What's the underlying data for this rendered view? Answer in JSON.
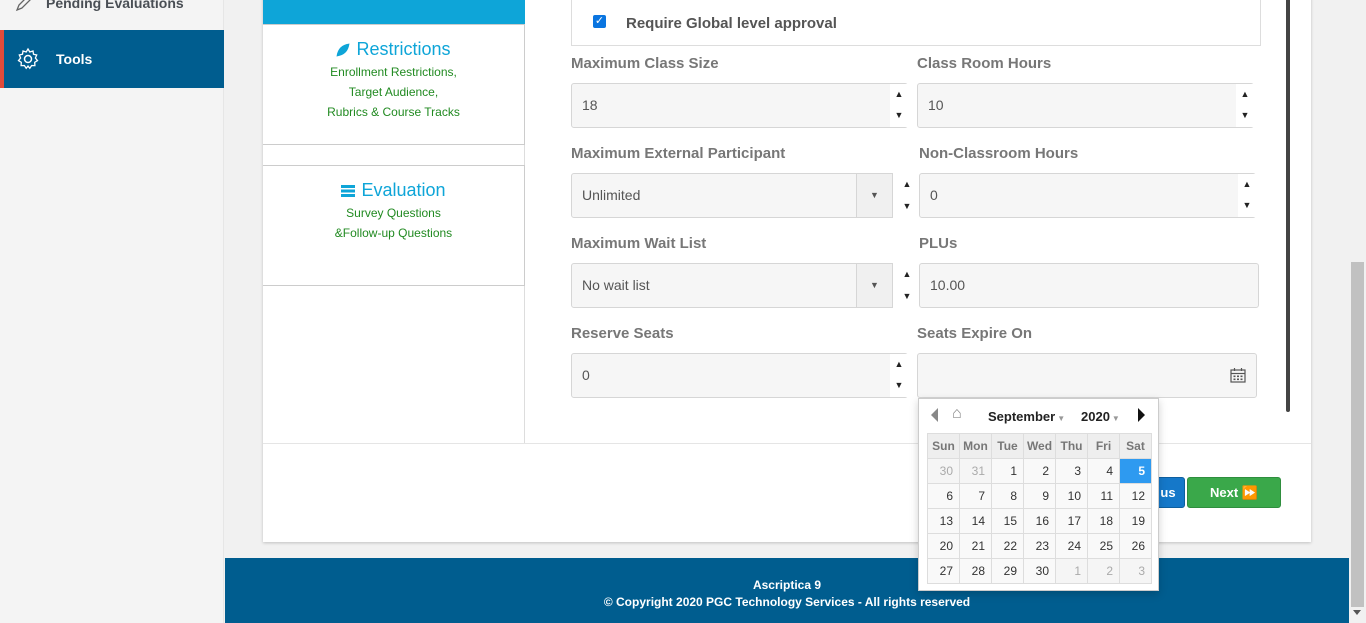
{
  "sidebar": {
    "items": [
      {
        "label": "Pending Evaluations",
        "icon": "pencil-icon"
      },
      {
        "label": "Tools",
        "icon": "gear-icon",
        "active": true
      }
    ]
  },
  "leftnav": {
    "restrictions": {
      "title": "Restrictions",
      "lines": [
        "Enrollment Restrictions,",
        "Target Audience,",
        "Rubrics & Course Tracks"
      ],
      "icon": "leaf-icon"
    },
    "evaluation": {
      "title": "Evaluation",
      "lines": [
        "Survey Questions",
        "&Follow-up Questions"
      ],
      "icon": "list-icon"
    }
  },
  "form": {
    "require_global_label": "Require Global level approval",
    "require_global_checked": true,
    "max_class_size": {
      "label": "Maximum Class Size",
      "value": "18"
    },
    "class_room_hours": {
      "label": "Class Room Hours",
      "value": "10"
    },
    "max_external": {
      "label": "Maximum External Participant",
      "value": "Unlimited"
    },
    "non_classroom_hours": {
      "label": "Non-Classroom Hours",
      "value": "0"
    },
    "max_wait_list": {
      "label": "Maximum Wait List",
      "value": "No wait list"
    },
    "plus": {
      "label": "PLUs",
      "value": "10.00"
    },
    "reserve_seats": {
      "label": "Reserve Seats",
      "value": "0"
    },
    "seats_expire": {
      "label": "Seats Expire On",
      "value": ""
    }
  },
  "buttons": {
    "previous_label": "us",
    "next_label": "Next ⏩"
  },
  "calendar": {
    "month": "September",
    "year": "2020",
    "weekdays": [
      "Sun",
      "Mon",
      "Tue",
      "Wed",
      "Thu",
      "Fri",
      "Sat"
    ],
    "weeks": [
      [
        "30",
        "31",
        "1",
        "2",
        "3",
        "4",
        "5"
      ],
      [
        "6",
        "7",
        "8",
        "9",
        "10",
        "11",
        "12"
      ],
      [
        "13",
        "14",
        "15",
        "16",
        "17",
        "18",
        "19"
      ],
      [
        "20",
        "21",
        "22",
        "23",
        "24",
        "25",
        "26"
      ],
      [
        "27",
        "28",
        "29",
        "30",
        "1",
        "2",
        "3"
      ]
    ],
    "selected_day": "5"
  },
  "footer": {
    "line1": "Ascriptica 9",
    "line2": "© Copyright 2020 PGC Technology Services - All rights reserved"
  },
  "colors": {
    "brand_blue": "#005d8f",
    "accent_cyan": "#0ea5d8",
    "next_green": "#3aa84a",
    "sidebar_accent": "#e04b3b"
  }
}
